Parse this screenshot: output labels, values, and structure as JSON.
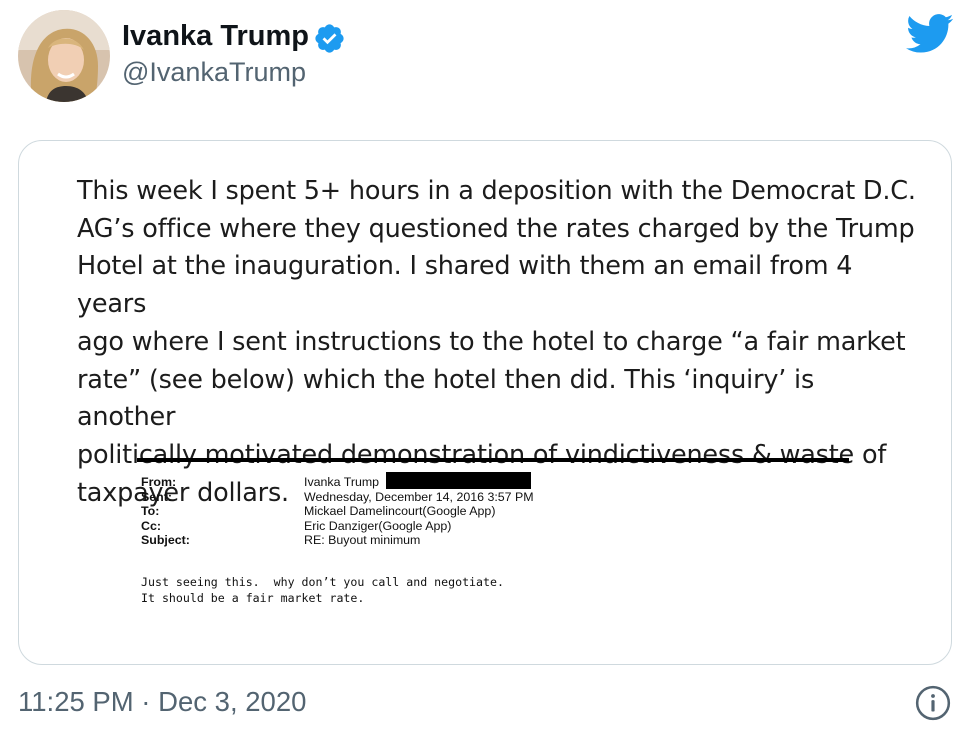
{
  "author": {
    "name": "Ivanka Trump",
    "handle": "@IvankaTrump",
    "verified_icon": "verified-badge-icon",
    "avatar": "avatar-photo"
  },
  "brand": {
    "icon": "twitter-bird-icon",
    "color": "#1d9bf0"
  },
  "media": {
    "statement_lines": [
      "This week I spent 5+ hours in a deposition with the Democrat D.C.",
      "AG’s office where they questioned the rates charged by the Trump",
      "Hotel at the inauguration. I shared with them an email from 4 years",
      "ago where I sent instructions to the hotel to charge “a fair market",
      "rate” (see below) which the hotel then did.  This ‘inquiry’ is another",
      "politically motivated demonstration of vindictiveness & waste of",
      "taxpayer dollars."
    ],
    "email": {
      "from_label": "From:",
      "from_value": "Ivanka Trump",
      "sent_label": "Sent:",
      "sent_value": "Wednesday, December 14, 2016 3:57 PM",
      "to_label": "To:",
      "to_value": "Mickael Damelincourt(Google App)",
      "cc_label": "Cc:",
      "cc_value": "Eric Danziger(Google App)",
      "subject_label": "Subject:",
      "subject_value": "RE: Buyout minimum",
      "body_lines": [
        "Just seeing this.  why don’t you call and negotiate.",
        "It should be a fair market rate."
      ]
    }
  },
  "footer": {
    "timestamp": "11:25 PM · Dec 3, 2020",
    "info_icon": "info-icon"
  },
  "colors": {
    "secondary_text": "#536471",
    "border": "#cfd9de",
    "verified": "#1d9bf0"
  }
}
